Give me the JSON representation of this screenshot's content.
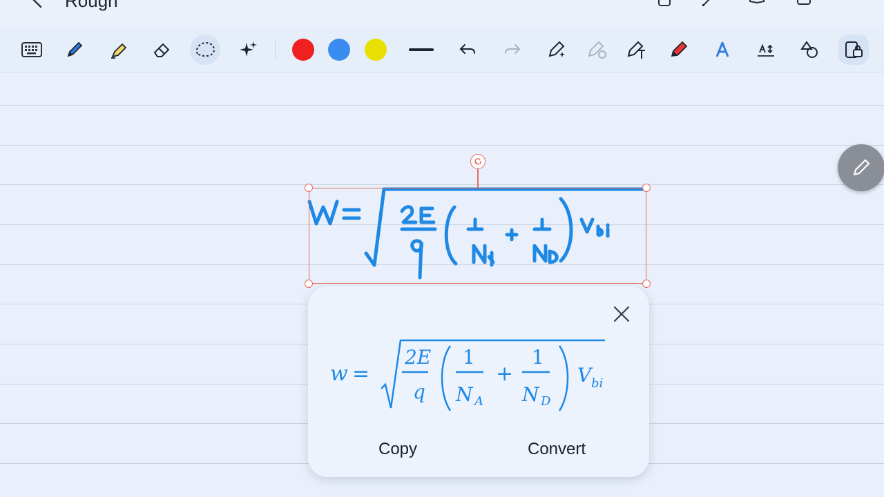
{
  "header": {
    "title": "Rough"
  },
  "toolbar": {
    "tools": [
      "keyboard-icon",
      "pen-icon",
      "highlighter-icon",
      "eraser-icon",
      "lasso-icon",
      "ai-sparkle-icon"
    ],
    "colors": [
      "#ef2020",
      "#3b8cf0",
      "#e8e000"
    ],
    "right_tools": [
      "undo-icon",
      "redo-icon",
      "magic-select-icon",
      "audio-pen-icon",
      "text-pen-icon",
      "red-marker-icon",
      "text-style-icon",
      "text-size-icon",
      "shapes-icon",
      "lock-icon"
    ]
  },
  "handwriting": {
    "accent": "#1e88e5"
  },
  "recognition_popup": {
    "formula": {
      "lhs": "w",
      "eq": "=",
      "num1": "2E",
      "den1": "q",
      "one": "1",
      "na": "N",
      "na_sub": "A",
      "plus": "+",
      "nd": "N",
      "nd_sub": "D",
      "v": "V",
      "v_sub": "bi"
    },
    "copy_label": "Copy",
    "convert_label": "Convert"
  },
  "floating": {
    "pen_button": "pencil-icon"
  }
}
